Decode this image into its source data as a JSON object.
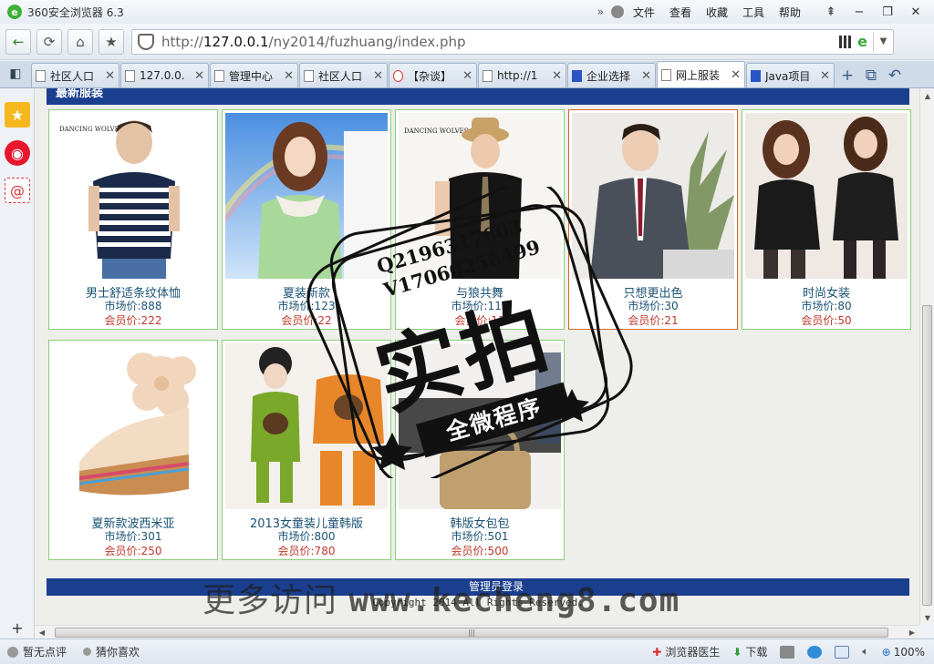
{
  "titlebar": {
    "title": "360安全浏览器 6.3",
    "logo_glyph": "e",
    "more_glyph": "»",
    "menu": [
      "文件",
      "查看",
      "收藏",
      "工具",
      "帮助"
    ],
    "window_buttons": [
      "pin-icon",
      "minimize-icon",
      "restore-icon",
      "close-icon"
    ]
  },
  "addressbar": {
    "url_prefix": "http://",
    "url_host": "127.0.0.1",
    "url_path": "/ny2014/fuzhuang/index.php"
  },
  "tabs": [
    {
      "label": "社区人口",
      "active": false
    },
    {
      "label": "127.0.0.",
      "active": false
    },
    {
      "label": "管理中心",
      "active": false
    },
    {
      "label": "社区人口",
      "active": false
    },
    {
      "label": "【杂谈】",
      "active": false
    },
    {
      "label": "http://1",
      "active": false
    },
    {
      "label": "企业选择",
      "active": false
    },
    {
      "label": "网上服装",
      "active": true
    },
    {
      "label": "Java项目",
      "active": false
    }
  ],
  "page": {
    "section_title": "最新服装",
    "products": [
      {
        "name": "男士舒适条纹体恤",
        "market": "市场价:888",
        "member": "会员价:222"
      },
      {
        "name": "夏装新款",
        "market": "市场价:123",
        "member": "会员价:22"
      },
      {
        "name": "与狼共舞",
        "market": "市场价:112",
        "member": "会员价:11"
      },
      {
        "name": "只想更出色",
        "market": "市场价:30",
        "member": "会员价:21"
      },
      {
        "name": "时尚女装",
        "market": "市场价:80",
        "member": "会员价:50"
      },
      {
        "name": "夏新款波西米亚",
        "market": "市场价:301",
        "member": "会员价:250"
      },
      {
        "name": "2013女童装儿童韩版",
        "market": "市场价:800",
        "member": "会员价:780"
      },
      {
        "name": "韩版女包包",
        "market": "市场价:501",
        "member": "会员价:500"
      }
    ],
    "admin_login": "管理员登录",
    "copyright": "Copyright 2014 All Rights Reserved."
  },
  "watermark": {
    "site_prefix": "更多访问",
    "site_url": "www.kecheng8.com",
    "stamp_line1": "Q2196317603",
    "stamp_line2": "V17060256499",
    "stamp_big": "实拍",
    "stamp_ribbon": "全微程序"
  },
  "statusbar": {
    "left": [
      "暂无点评",
      "猜你喜欢"
    ],
    "doctor": "浏览器医生",
    "download": "下载",
    "zoom": "100%"
  }
}
